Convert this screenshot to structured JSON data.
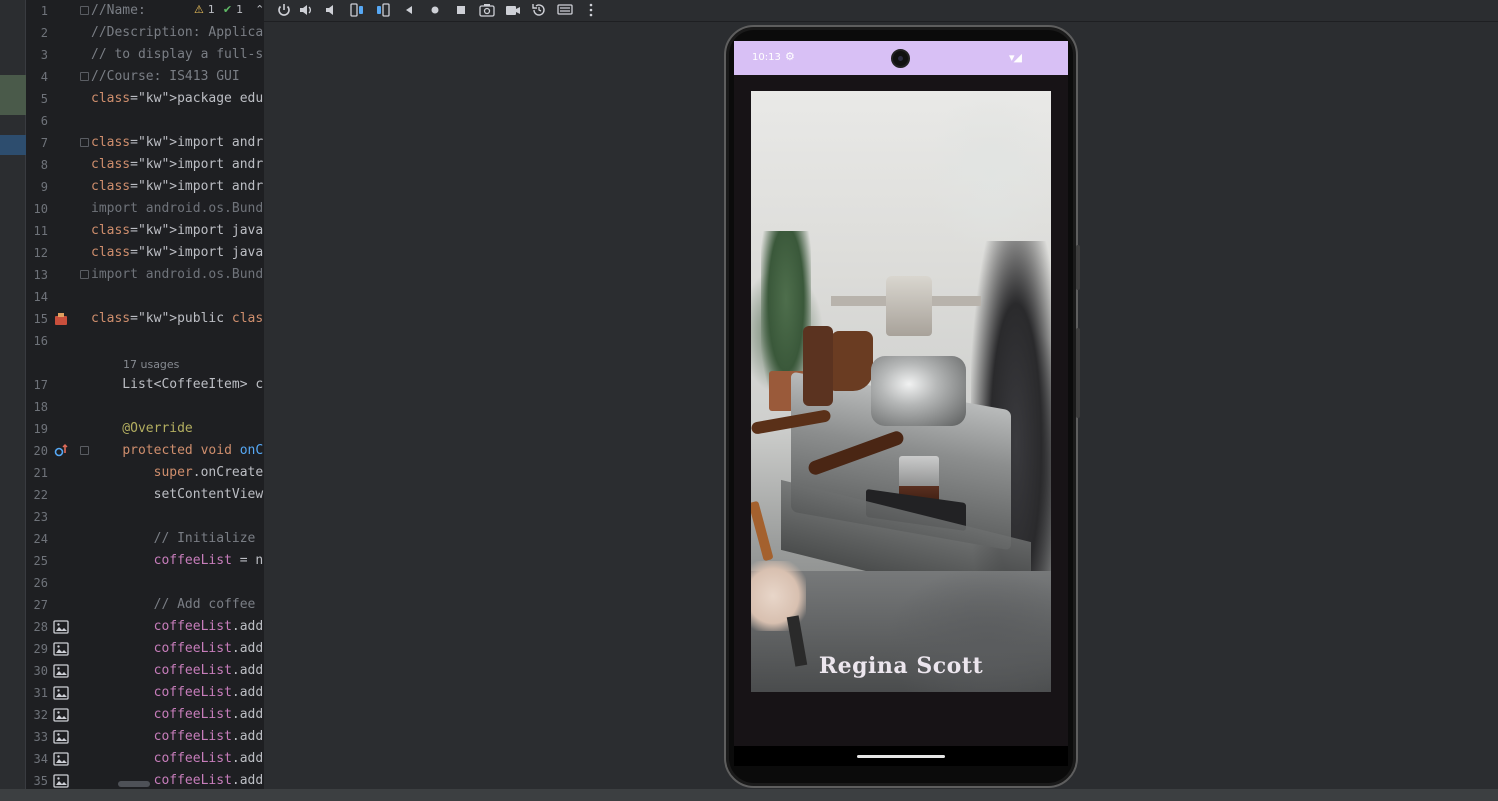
{
  "editor": {
    "inspection": {
      "warnings": "1",
      "weak_warnings": "1"
    },
    "usage_hint": "17 usages",
    "lines": [
      {
        "n": "1",
        "text": "//Name: "
      },
      {
        "n": "2",
        "text": "//Description: Applica"
      },
      {
        "n": "3",
        "text": "// to display a full-s"
      },
      {
        "n": "4",
        "text": "//Course: IS413 GUI"
      },
      {
        "n": "5",
        "text": "package edu.umbc.coffe"
      },
      {
        "n": "6",
        "text": ""
      },
      {
        "n": "7",
        "text": "import androidx.appcom"
      },
      {
        "n": "8",
        "text": "import androidx.recycl"
      },
      {
        "n": "9",
        "text": "import androidx.recycl"
      },
      {
        "n": "10",
        "text": "import android.os.Bund"
      },
      {
        "n": "11",
        "text": "import java.util.Array"
      },
      {
        "n": "12",
        "text": "import java.util.List;"
      },
      {
        "n": "13",
        "text": "import android.os.Bund"
      },
      {
        "n": "14",
        "text": ""
      },
      {
        "n": "15",
        "text": "public class MainActiv"
      },
      {
        "n": "16",
        "text": ""
      },
      {
        "n": "17",
        "text": "    List<CoffeeItem> c"
      },
      {
        "n": "18",
        "text": ""
      },
      {
        "n": "19",
        "text": "    @Override"
      },
      {
        "n": "20",
        "text": "    protected void onC"
      },
      {
        "n": "21",
        "text": "        super.onCreate"
      },
      {
        "n": "22",
        "text": "        setContentView"
      },
      {
        "n": "23",
        "text": ""
      },
      {
        "n": "24",
        "text": "        // Initialize "
      },
      {
        "n": "25",
        "text": "        coffeeList = n"
      },
      {
        "n": "26",
        "text": ""
      },
      {
        "n": "27",
        "text": "        // Add coffee "
      },
      {
        "n": "28",
        "text": "        coffeeList.add"
      },
      {
        "n": "29",
        "text": "        coffeeList.add"
      },
      {
        "n": "30",
        "text": "        coffeeList.add"
      },
      {
        "n": "31",
        "text": "        coffeeList.add"
      },
      {
        "n": "32",
        "text": "        coffeeList.add"
      },
      {
        "n": "33",
        "text": "        coffeeList.add"
      },
      {
        "n": "34",
        "text": "        coffeeList.add"
      },
      {
        "n": "35",
        "text": "        coffeeList.add"
      }
    ]
  },
  "toolbar": {
    "icons": [
      "power-icon",
      "volume-up-icon",
      "volume-down-icon",
      "rotate-left-icon",
      "rotate-right-icon",
      "back-icon",
      "home-icon",
      "overview-icon",
      "screenshot-icon",
      "screen-record-icon",
      "snapshot-icon",
      "keyboard-icon",
      "more-icon"
    ]
  },
  "device": {
    "status_time": "10:13",
    "caption": "Regina Scott"
  }
}
